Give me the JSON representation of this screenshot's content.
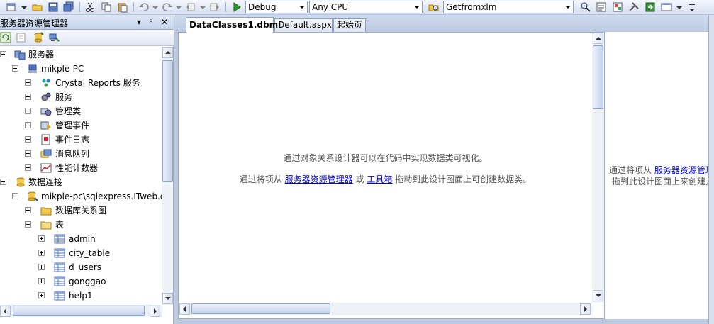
{
  "toolbar": {
    "config_value": "Debug",
    "platform_value": "Any CPU",
    "find_value": "Getfromxlm"
  },
  "left_panel": {
    "title": "服务器资源管理器",
    "pin": "ᵖ",
    "close": "✕"
  },
  "tree": {
    "servers": "服务器",
    "machine": "mikple-PC",
    "crystal": "Crystal Reports 服务",
    "services": "服务",
    "mgmt_classes": "管理类",
    "mgmt_events": "管理事件",
    "event_logs": "事件日志",
    "msg_queues": "消息队列",
    "perf_counters": "性能计数器",
    "data_connections": "数据连接",
    "connection": "mikple-pc\\sqlexpress.ITweb.dbo",
    "db_diagrams": "数据库关系图",
    "tables": "表",
    "table_items": [
      "admin",
      "city_table",
      "d_users",
      "gonggao",
      "help1"
    ]
  },
  "tabs": [
    {
      "label": "DataClasses1.dbml"
    },
    {
      "label": "Default.aspx"
    },
    {
      "label": "起始页"
    }
  ],
  "designer": {
    "line1": "通过对象关系设计器可以在代码中实现数据类可视化。",
    "line2_pre": "通过将项从",
    "link_server": "服务器资源管理器",
    "or": "或",
    "link_toolbox": "工具箱",
    "line2_post": "拖动到此设计图面上可创建数据类。"
  },
  "right_pane": {
    "line1_pre": "通过将项从",
    "link": "服务器资源管理",
    "line2": "拖到此设计图面上来创建方"
  },
  "colors": {
    "toolbar": "#d5def0",
    "accent": "#9aaccb",
    "link": "#0000cc"
  }
}
